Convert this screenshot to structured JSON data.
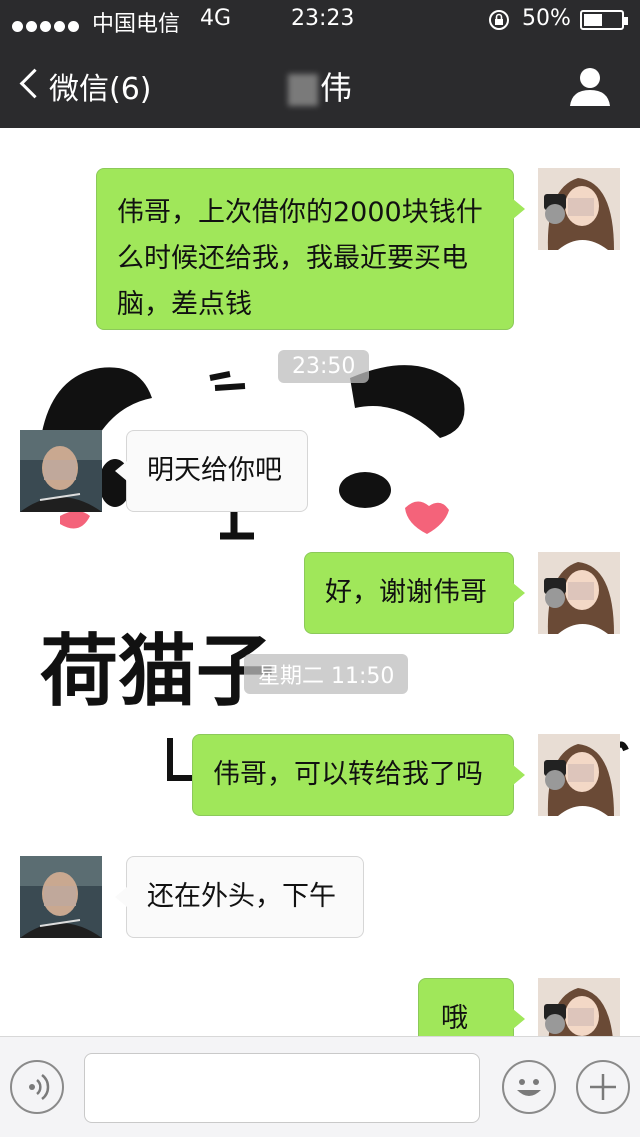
{
  "status_bar": {
    "carrier": "中国电信",
    "network": "4G",
    "time": "23:23",
    "battery": "50%",
    "battery_level": 0.5
  },
  "nav": {
    "back_label": "微信(6)",
    "title": "伟",
    "profile_icon": "person-icon"
  },
  "messages": [
    {
      "side": "out",
      "text_lines": [
        "伟哥，上次借你的2000块钱什",
        "么时候还给我，我最近要买电",
        "脑，差点钱"
      ]
    },
    {
      "type": "time",
      "text": "23:50"
    },
    {
      "side": "in",
      "text": "明天给你吧"
    },
    {
      "side": "out",
      "text": "好，谢谢伟哥"
    },
    {
      "type": "time",
      "text": "星期二 11:50"
    },
    {
      "side": "out",
      "text": "伟哥，可以转给我了吗"
    },
    {
      "side": "in",
      "text": "还在外头，下午"
    },
    {
      "side": "out",
      "text": "哦"
    }
  ],
  "sticker": {
    "text": "荷猫子"
  },
  "input_bar": {
    "voice_icon": "voice-icon",
    "emoji_icon": "emoji-icon",
    "plus_icon": "plus-icon",
    "text_value": ""
  },
  "colors": {
    "bar_bg": "#2b2b2d",
    "outgoing_bubble": "#a0e75a",
    "incoming_bubble": "#fafafa"
  }
}
